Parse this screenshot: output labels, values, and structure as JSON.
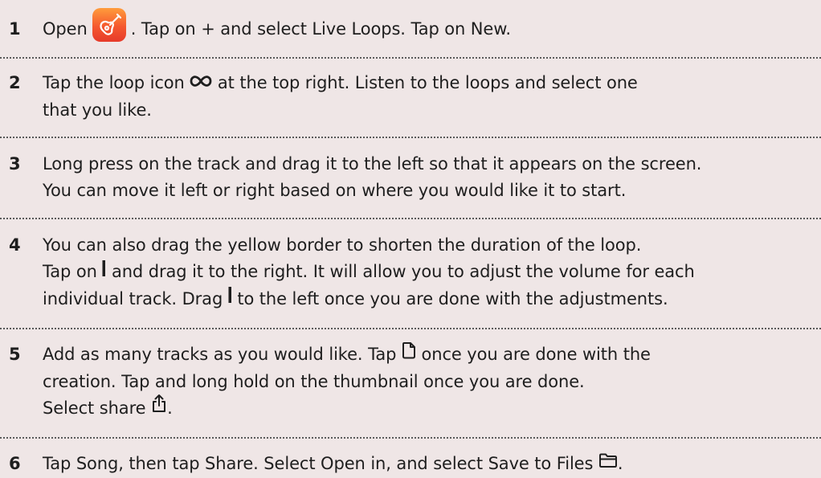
{
  "steps": [
    {
      "number": "1",
      "parts": {
        "before_icon": "Open",
        "after_icon": ". Tap on + and select Live Loops. Tap on New."
      },
      "icon": "garageband-app-icon"
    },
    {
      "number": "2",
      "lines": {
        "l1_before": "Tap the loop icon",
        "l1_after": "at the top right. Listen to the loops and select one",
        "l2": "that you like."
      },
      "icon": "infinity-loop-icon"
    },
    {
      "number": "3",
      "lines": {
        "l1": "Long press on the track and drag it to the left so that it appears on the screen.",
        "l2": "You can move it left or right based on where you would like it to start."
      }
    },
    {
      "number": "4",
      "lines": {
        "l1": "You can also drag the yellow border to shorten the duration of the loop.",
        "l2_before": "Tap on",
        "l2_after": "and drag it to the right. It will allow you to adjust the volume for each",
        "l3_before": "individual track. Drag",
        "l3_after": "to the left once you are done with the adjustments."
      },
      "icon": "vertical-bar-icon"
    },
    {
      "number": "5",
      "lines": {
        "l1_before": "Add as many tracks as you would like. Tap",
        "l1_after": "once you are done with the",
        "l2": "creation. Tap and long hold on the thumbnail once you are done.",
        "l3_before": "Select share",
        "l3_after": "."
      },
      "icons": [
        "document-icon",
        "share-icon"
      ]
    },
    {
      "number": "6",
      "lines": {
        "l1_before": "Tap Song, then tap Share. Select Open in, and select Save to Files",
        "l1_after": "."
      },
      "icon": "folder-icon"
    }
  ],
  "colors": {
    "background": "#efe6e6",
    "text": "#1e1e1e",
    "divider": "#5a5a5a",
    "app_icon_top": "#ff9c3c",
    "app_icon_bottom": "#e63a2a"
  }
}
